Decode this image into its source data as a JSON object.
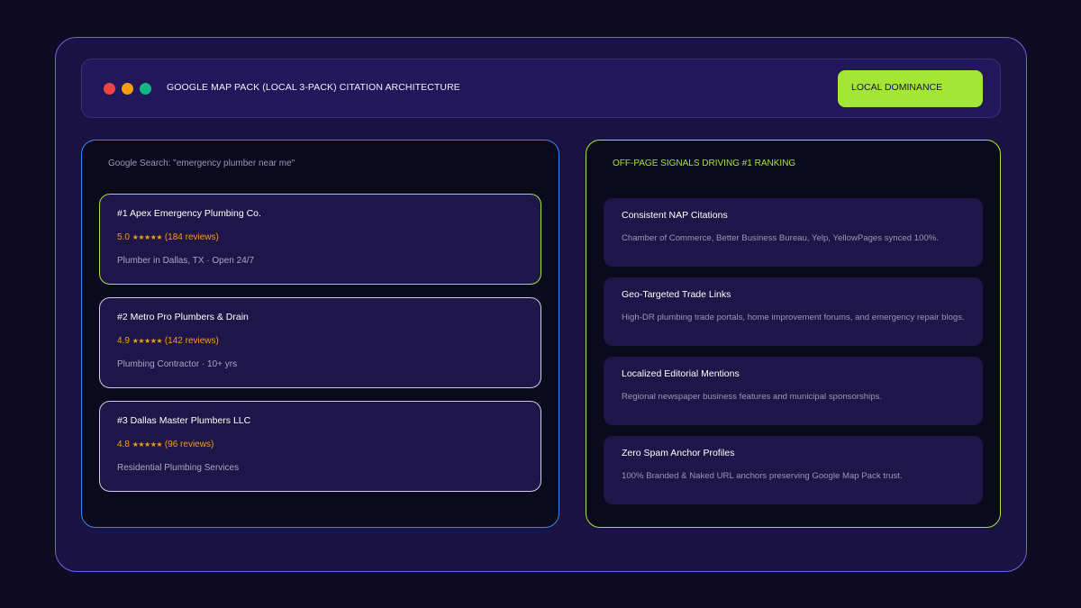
{
  "header": {
    "title": "GOOGLE MAP PACK (LOCAL 3-PACK) CITATION ARCHITECTURE",
    "badge": "LOCAL DOMINANCE",
    "window_dots": [
      "red",
      "amber",
      "green"
    ]
  },
  "search": {
    "heading": "Google Search: \"emergency plumber near me\"",
    "results": [
      {
        "name": "#1 Apex Emergency Plumbing Co.",
        "score": "5.0",
        "stars": "★★★★★",
        "reviews": "(184 reviews)",
        "meta": "Plumber in Dallas, TX · Open 24/7"
      },
      {
        "name": "#2 Metro Pro Plumbers & Drain",
        "score": "4.9",
        "stars": "★★★★★",
        "reviews": "(142 reviews)",
        "meta": "Plumbing Contractor · 10+ yrs"
      },
      {
        "name": "#3 Dallas Master Plumbers LLC",
        "score": "4.8",
        "stars": "★★★★★",
        "reviews": "(96 reviews)",
        "meta": "Residential Plumbing Services"
      }
    ]
  },
  "signals": {
    "heading": "OFF-PAGE SIGNALS DRIVING #1 RANKING",
    "items": [
      {
        "title": "Consistent NAP Citations",
        "desc": "Chamber of Commerce, Better Business Bureau, Yelp, YellowPages synced 100%."
      },
      {
        "title": "Geo-Targeted Trade Links",
        "desc": "High-DR plumbing trade portals, home improvement forums, and emergency repair blogs."
      },
      {
        "title": "Localized Editorial Mentions",
        "desc": "Regional newspaper business features and municipal sponsorships."
      },
      {
        "title": "Zero Spam Anchor Profiles",
        "desc": "100% Branded & Naked URL anchors preserving Google Map Pack trust."
      }
    ]
  },
  "colors": {
    "accent_lime": "#a3e635",
    "accent_blue": "#3b82f6",
    "star_amber": "#f59e0b",
    "frame_border": "#6a63e8"
  }
}
